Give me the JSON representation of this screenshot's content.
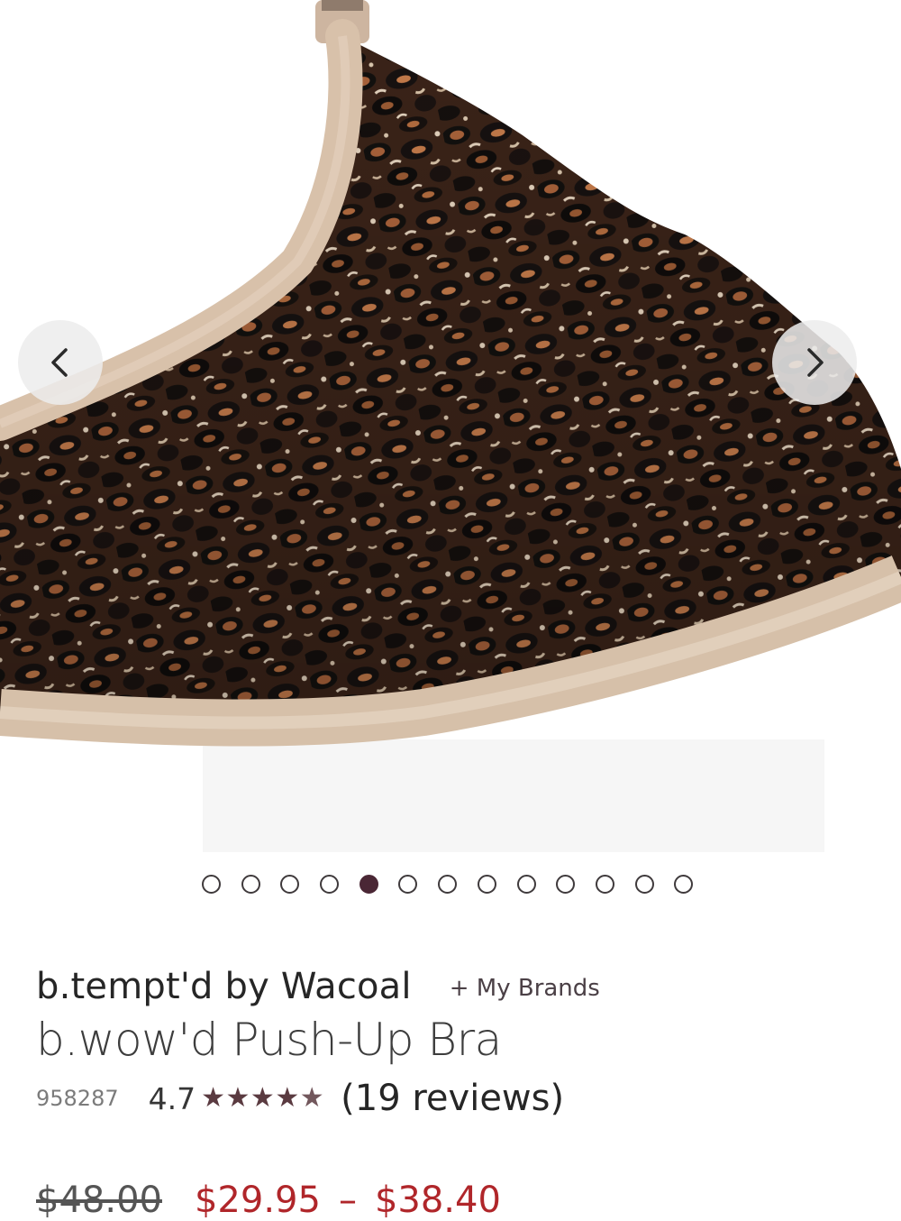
{
  "gallery": {
    "image_alt": "Leopard print push-up bra",
    "slide_count": 13,
    "active_index": 4,
    "prev_icon": "chevron-left-icon",
    "next_icon": "chevron-right-icon",
    "colors": {
      "band": "#d9bfa6",
      "print_dark": "#1b1310",
      "print_brown": "#9a5a33",
      "print_light": "#e3d2bd"
    }
  },
  "product": {
    "brand": "b.tempt'd by Wacoal",
    "my_brands_label": "+ My Brands",
    "title": "b.wow'd Push-Up Bra",
    "sku": "958287",
    "rating": "4.7",
    "rating_value": 4.7,
    "rating_max": 5,
    "reviews_label": "(19 reviews)"
  },
  "price": {
    "original": "$48.00",
    "sale_low": "$29.95",
    "separator": "–",
    "sale_high": "$38.40",
    "sale_color": "#b0262a"
  }
}
